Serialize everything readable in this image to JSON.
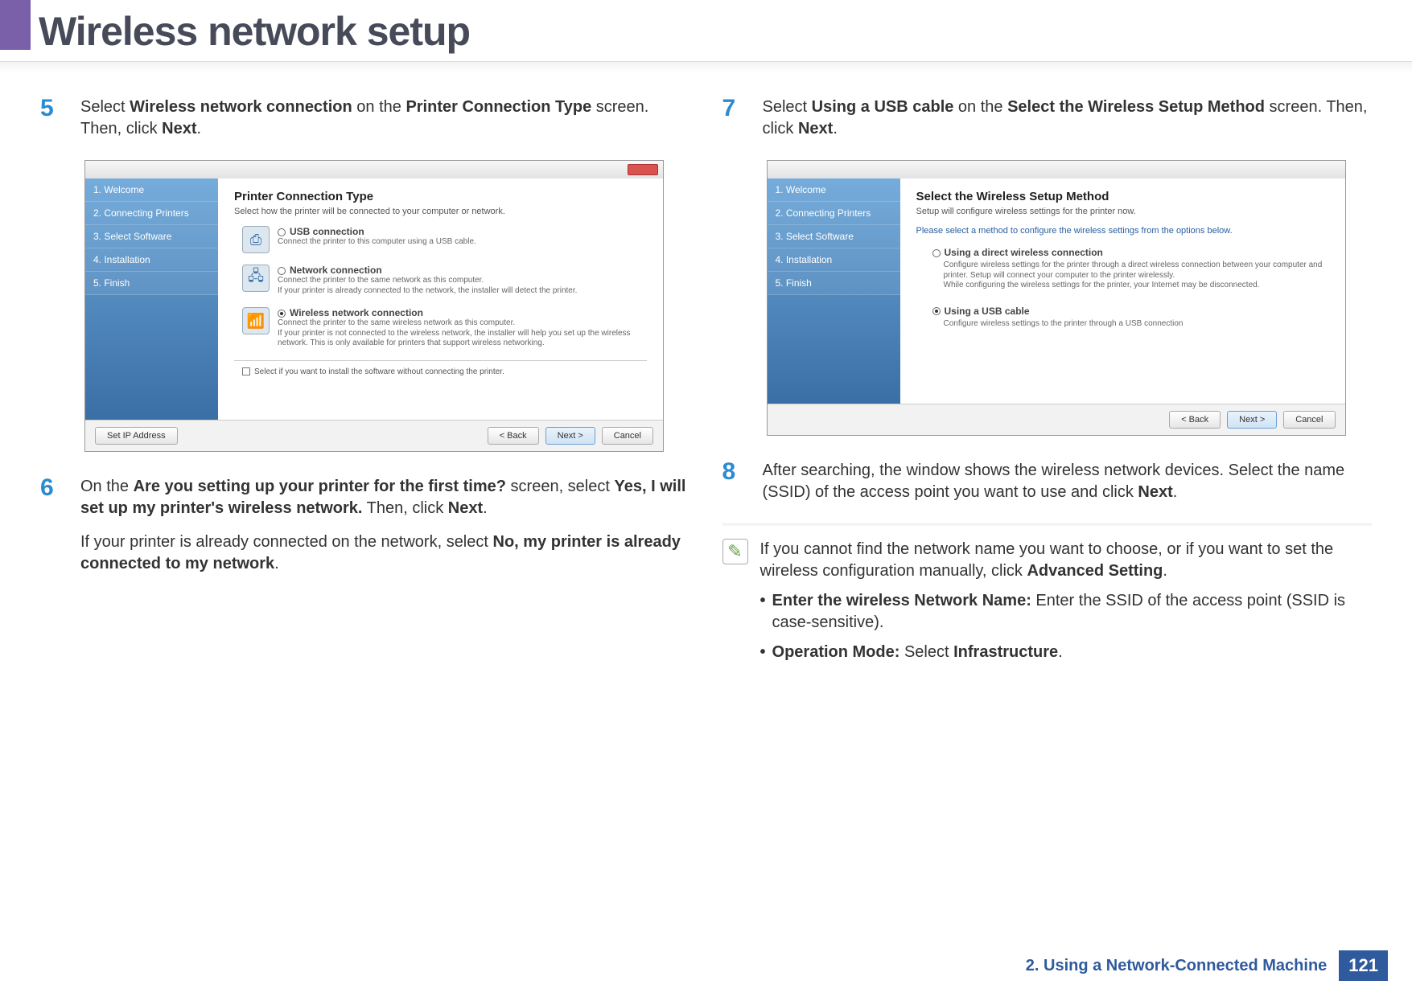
{
  "header": {
    "title": "Wireless network setup"
  },
  "steps": {
    "s5": {
      "num": "5",
      "parts": [
        "Select ",
        "Wireless network connection",
        " on the ",
        "Printer Connection Type",
        " screen. Then, click ",
        "Next",
        "."
      ]
    },
    "s6": {
      "num": "6",
      "p1_parts": [
        "On the ",
        "Are you setting up your printer for the first time?",
        " screen, select ",
        "Yes, I will set up my printer's wireless network.",
        " Then, click ",
        "Next",
        "."
      ],
      "p2_parts": [
        "If your printer is already connected on the network, select ",
        "No, my printer is already connected to my network",
        "."
      ]
    },
    "s7": {
      "num": "7",
      "parts": [
        "Select ",
        "Using a USB cable",
        " on the ",
        "Select the Wireless Setup Method",
        " screen. Then, click ",
        "Next",
        "."
      ]
    },
    "s8": {
      "num": "8",
      "parts": [
        "After searching, the window shows the wireless network devices. Select the name (SSID) of the access point you want to use and click ",
        "Next",
        "."
      ]
    }
  },
  "mock1": {
    "sidebar": [
      "1. Welcome",
      "2. Connecting Printers",
      "3. Select Software",
      "4. Installation",
      "5. Finish"
    ],
    "title": "Printer Connection Type",
    "subtitle": "Select how the printer will be connected to your computer or network.",
    "opt1": {
      "title": "USB connection",
      "desc": "Connect the printer to this computer using a USB cable."
    },
    "opt2": {
      "title": "Network connection",
      "desc": "Connect the printer to the same network as this computer.\nIf your printer is already connected to the network, the installer will detect the printer."
    },
    "opt3": {
      "title": "Wireless network connection",
      "desc": "Connect the printer to the same wireless network as this computer.\nIf your printer is not connected to the wireless network, the installer will help you set up the wireless network. This is only available for printers that support wireless networking."
    },
    "check": "Select if you want to install the software without connecting the printer.",
    "btn_ip": "Set IP Address",
    "btn_back": "< Back",
    "btn_next": "Next >",
    "btn_cancel": "Cancel"
  },
  "mock2": {
    "sidebar": [
      "1. Welcome",
      "2. Connecting Printers",
      "3. Select Software",
      "4. Installation",
      "5. Finish"
    ],
    "title": "Select the Wireless Setup Method",
    "subtitle": "Setup will configure wireless settings for the printer now.",
    "subtitle2": "Please select a method to configure the wireless settings from the options below.",
    "opt1": {
      "title": "Using a direct wireless connection",
      "desc": "Configure wireless settings for the printer through a direct wireless connection between your computer and printer. Setup will connect your computer to the printer wirelessly.\nWhile configuring the wireless settings for the printer, your Internet may be disconnected."
    },
    "opt2": {
      "title": "Using a USB cable",
      "desc": "Configure wireless settings to the printer through a USB connection"
    },
    "btn_back": "< Back",
    "btn_next": "Next >",
    "btn_cancel": "Cancel"
  },
  "note": {
    "lead_parts": [
      "If you cannot find the network name you want to choose, or if you want to set the wireless configuration manually, click ",
      "Advanced Setting",
      "."
    ],
    "b1_parts": [
      "Enter the wireless Network Name:",
      " Enter the SSID of the access point (SSID is case-sensitive)."
    ],
    "b2_parts": [
      "Operation Mode:",
      " Select ",
      "Infrastructure",
      "."
    ]
  },
  "footer": {
    "chapter": "2.  Using a Network-Connected Machine",
    "page": "121"
  }
}
